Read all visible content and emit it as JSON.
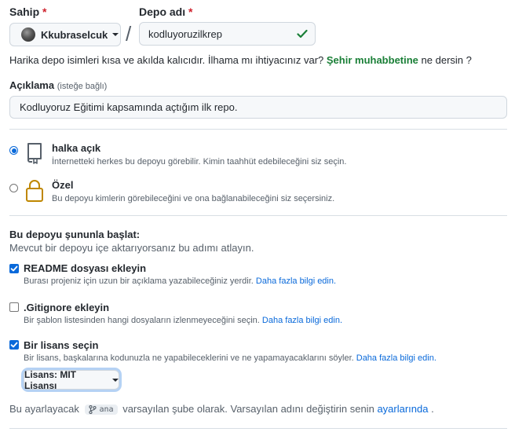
{
  "owner": {
    "label": "Sahip",
    "required_mark": "*",
    "value": "Kkubraselcuk"
  },
  "separator": "/",
  "repo": {
    "label": "Depo adı",
    "required_mark": "*",
    "value": "kodluyoruzilkrep"
  },
  "hint": {
    "text": "Harika depo isimleri kısa ve akılda kalıcıdır. İlhama mı ihtiyacınız var?",
    "suggestion": "Şehir muhabbetine",
    "suffix": "ne dersin ?"
  },
  "description": {
    "label": "Açıklama",
    "optional": "(isteğe bağlı)",
    "value": "Kodluyoruz Eğitimi kapsamında açtığım ilk repo."
  },
  "visibility": {
    "public": {
      "title": "halka açık",
      "desc": "İnternetteki herkes bu depoyu görebilir. Kimin taahhüt edebileceğini siz seçin.",
      "checked": true
    },
    "private": {
      "title": "Özel",
      "desc": "Bu depoyu kimlerin görebileceğini ve ona bağlanabileceğini siz seçersiniz.",
      "checked": false
    }
  },
  "init": {
    "title": "Bu depoyu şununla başlat:",
    "subtitle": "Mevcut bir depoyu içe aktarıyorsanız bu adımı atlayın.",
    "readme": {
      "label": "README dosyası ekleyin",
      "desc": "Burası projeniz için uzun bir açıklama yazabileceğiniz yerdir.",
      "link": "Daha fazla bilgi edin.",
      "checked": true
    },
    "gitignore": {
      "label": ".Gitignore ekleyin",
      "desc": "Bir şablon listesinden hangi dosyaların izlenmeyeceğini seçin.",
      "link": "Daha fazla bilgi edin.",
      "checked": false
    },
    "license": {
      "label": "Bir lisans seçin",
      "desc": "Bir lisans, başkalarına kodunuzla ne yapabileceklerini ve ne yapamayacaklarını söyler.",
      "link": "Daha fazla bilgi edin.",
      "checked": true,
      "button": "Lisans: MIT Lisansı"
    }
  },
  "branch_note": {
    "prefix": "Bu ayarlayacak",
    "branch": "ana",
    "middle": "varsayılan şube olarak. Varsayılan adını değiştirin senin",
    "link": "ayarlarında",
    "suffix": "."
  },
  "colors": {
    "accent": "#0969da",
    "success": "#1a7f37",
    "required": "#cf222e",
    "lock": "#bf8700"
  }
}
